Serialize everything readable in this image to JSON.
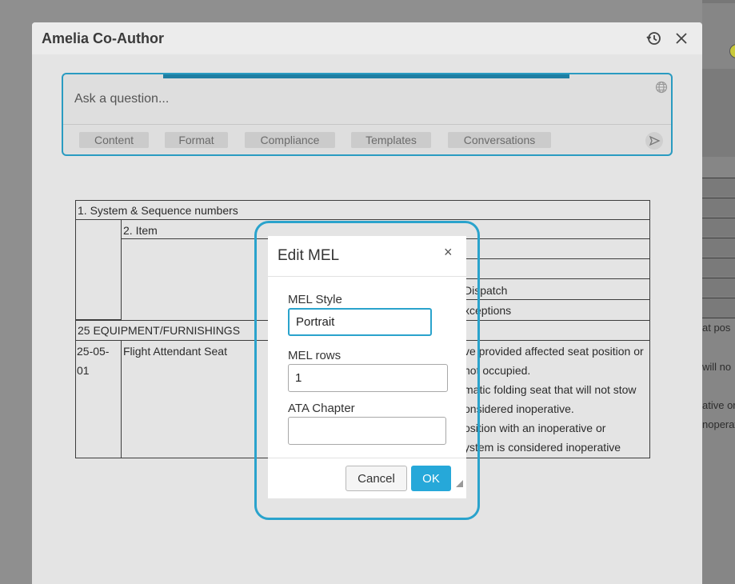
{
  "panel": {
    "title": "Amelia Co-Author"
  },
  "ask": {
    "placeholder": "Ask a question...",
    "chips": [
      "Content",
      "Format",
      "Compliance",
      "Templates",
      "Conversations"
    ]
  },
  "document": {
    "header1": "1. System & Sequence numbers",
    "header2": "2. Item",
    "header3": "Dispatch",
    "header4": "xceptions",
    "section": "25 EQUIPMENT/FURNISHINGS",
    "row_id_line1": "25-05-",
    "row_id_line2": "01",
    "row_item": "Flight Attendant Seat",
    "remarks": [
      "ve provided affected seat position or",
      "not occupied.",
      "matic folding seat that will not stow",
      "onsidered inoperative.",
      "osition with an inoperative or",
      "ystem is considered inoperative"
    ],
    "right_peek": [
      "at pos",
      "will no",
      "ative or",
      "noperat"
    ]
  },
  "dialog": {
    "title": "Edit MEL",
    "close": "×",
    "mel_style_label": "MEL Style",
    "mel_style_value": "Portrait",
    "mel_rows_label": "MEL rows",
    "mel_rows_value": "1",
    "ata_chapter_label": "ATA Chapter",
    "ata_chapter_value": "",
    "cancel_label": "Cancel",
    "ok_label": "OK"
  },
  "colors": {
    "accent": "#2aa3cc",
    "ok_button": "#26a8d9",
    "progress": "#1f7fa3"
  }
}
